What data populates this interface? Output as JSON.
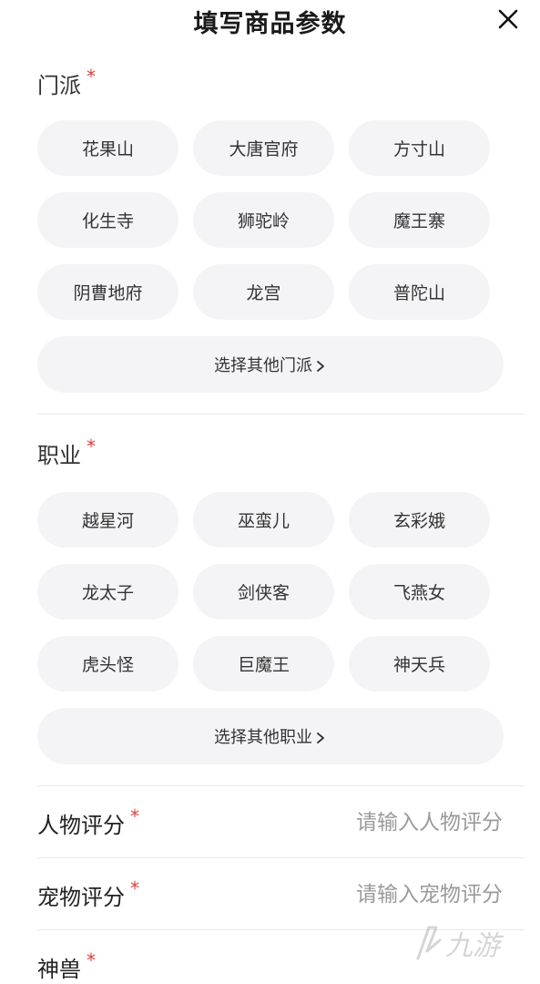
{
  "header": {
    "title": "填写商品参数"
  },
  "sect": {
    "label": "门派",
    "required_mark": "*",
    "options": [
      "花果山",
      "大唐官府",
      "方寸山",
      "化生寺",
      "狮驼岭",
      "魔王寨",
      "阴曹地府",
      "龙宫",
      "普陀山"
    ],
    "more_label": "选择其他门派"
  },
  "profession": {
    "label": "职业",
    "required_mark": "*",
    "options": [
      "越星河",
      "巫蛮儿",
      "玄彩娥",
      "龙太子",
      "剑侠客",
      "飞燕女",
      "虎头怪",
      "巨魔王",
      "神天兵"
    ],
    "more_label": "选择其他职业"
  },
  "fields": {
    "character_score": {
      "label": "人物评分",
      "required_mark": "*",
      "placeholder": "请输入人物评分"
    },
    "pet_score": {
      "label": "宠物评分",
      "required_mark": "*",
      "placeholder": "请输入宠物评分"
    },
    "divine_beast": {
      "label": "神兽",
      "required_mark": "*"
    }
  },
  "watermark": {
    "text": "九游"
  },
  "colors": {
    "required": "#e23b3b",
    "chip_bg": "#f4f4f6",
    "placeholder": "#9a9a9a",
    "divider": "#e9e9ec"
  }
}
